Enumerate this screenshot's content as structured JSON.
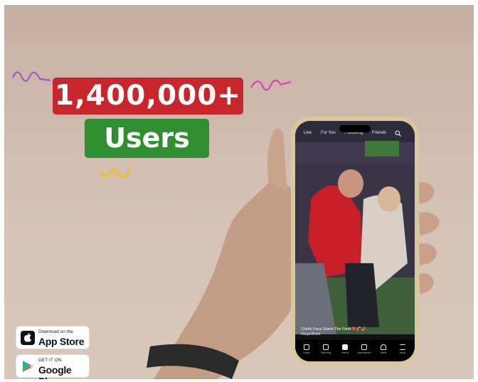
{
  "headline": {
    "count": "1,400,000+",
    "label": "Users"
  },
  "colors": {
    "count_badge": "#c8262c",
    "users_badge": "#2f8e2f",
    "background": "#c7b0a2"
  },
  "phone": {
    "top_tabs": [
      "Live",
      "For You",
      "Following",
      "Friends"
    ],
    "search_icon": "search-icon",
    "caption": "Chiefs Fans Storm The Field ❤️🏈🎉",
    "hashtag": "#SuperBowl",
    "bottom_tabs": [
      "Home",
      "Following",
      "Videos",
      "Marketplace",
      "Alerts",
      "Menu"
    ]
  },
  "stores": [
    {
      "small": "Download on the",
      "big": "App Store",
      "icon": "apple-icon"
    },
    {
      "small": "GET IT ON",
      "big": "Google Play",
      "icon": "google-play-icon"
    }
  ]
}
